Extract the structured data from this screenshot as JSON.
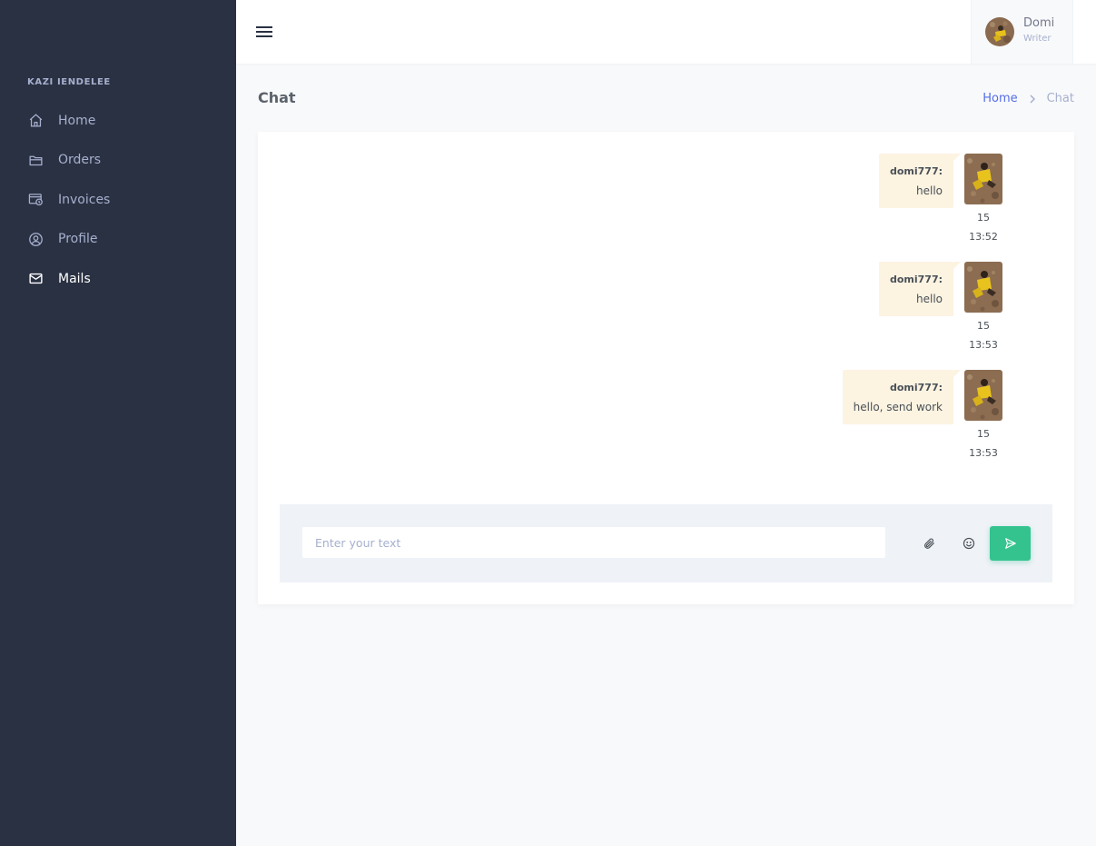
{
  "sidebar": {
    "menu_title": "KAZI IENDELEE",
    "items": [
      {
        "label": "Home",
        "icon": "home-icon"
      },
      {
        "label": "Orders",
        "icon": "folder-icon"
      },
      {
        "label": "Invoices",
        "icon": "invoice-icon"
      },
      {
        "label": "Profile",
        "icon": "user-circle-icon"
      },
      {
        "label": "Mails",
        "icon": "mail-icon",
        "active": true
      }
    ]
  },
  "topbar": {
    "user": {
      "name": "Domi",
      "role": "Writer"
    }
  },
  "page": {
    "title": "Chat",
    "breadcrumb": {
      "home": "Home",
      "current": "Chat"
    }
  },
  "chat": {
    "messages": [
      {
        "author": "domi777:",
        "text": "hello",
        "time_day": "15",
        "time_clock": "13:52"
      },
      {
        "author": "domi777:",
        "text": "hello",
        "time_day": "15",
        "time_clock": "13:53"
      },
      {
        "author": "domi777:",
        "text": "hello, send work",
        "time_day": "15",
        "time_clock": "13:53"
      }
    ],
    "input_placeholder": "Enter your text"
  },
  "colors": {
    "sidebar_bg": "#2a3142",
    "accent": "#556ee6",
    "send": "#34c38f",
    "bubble": "#fcf3e1"
  }
}
